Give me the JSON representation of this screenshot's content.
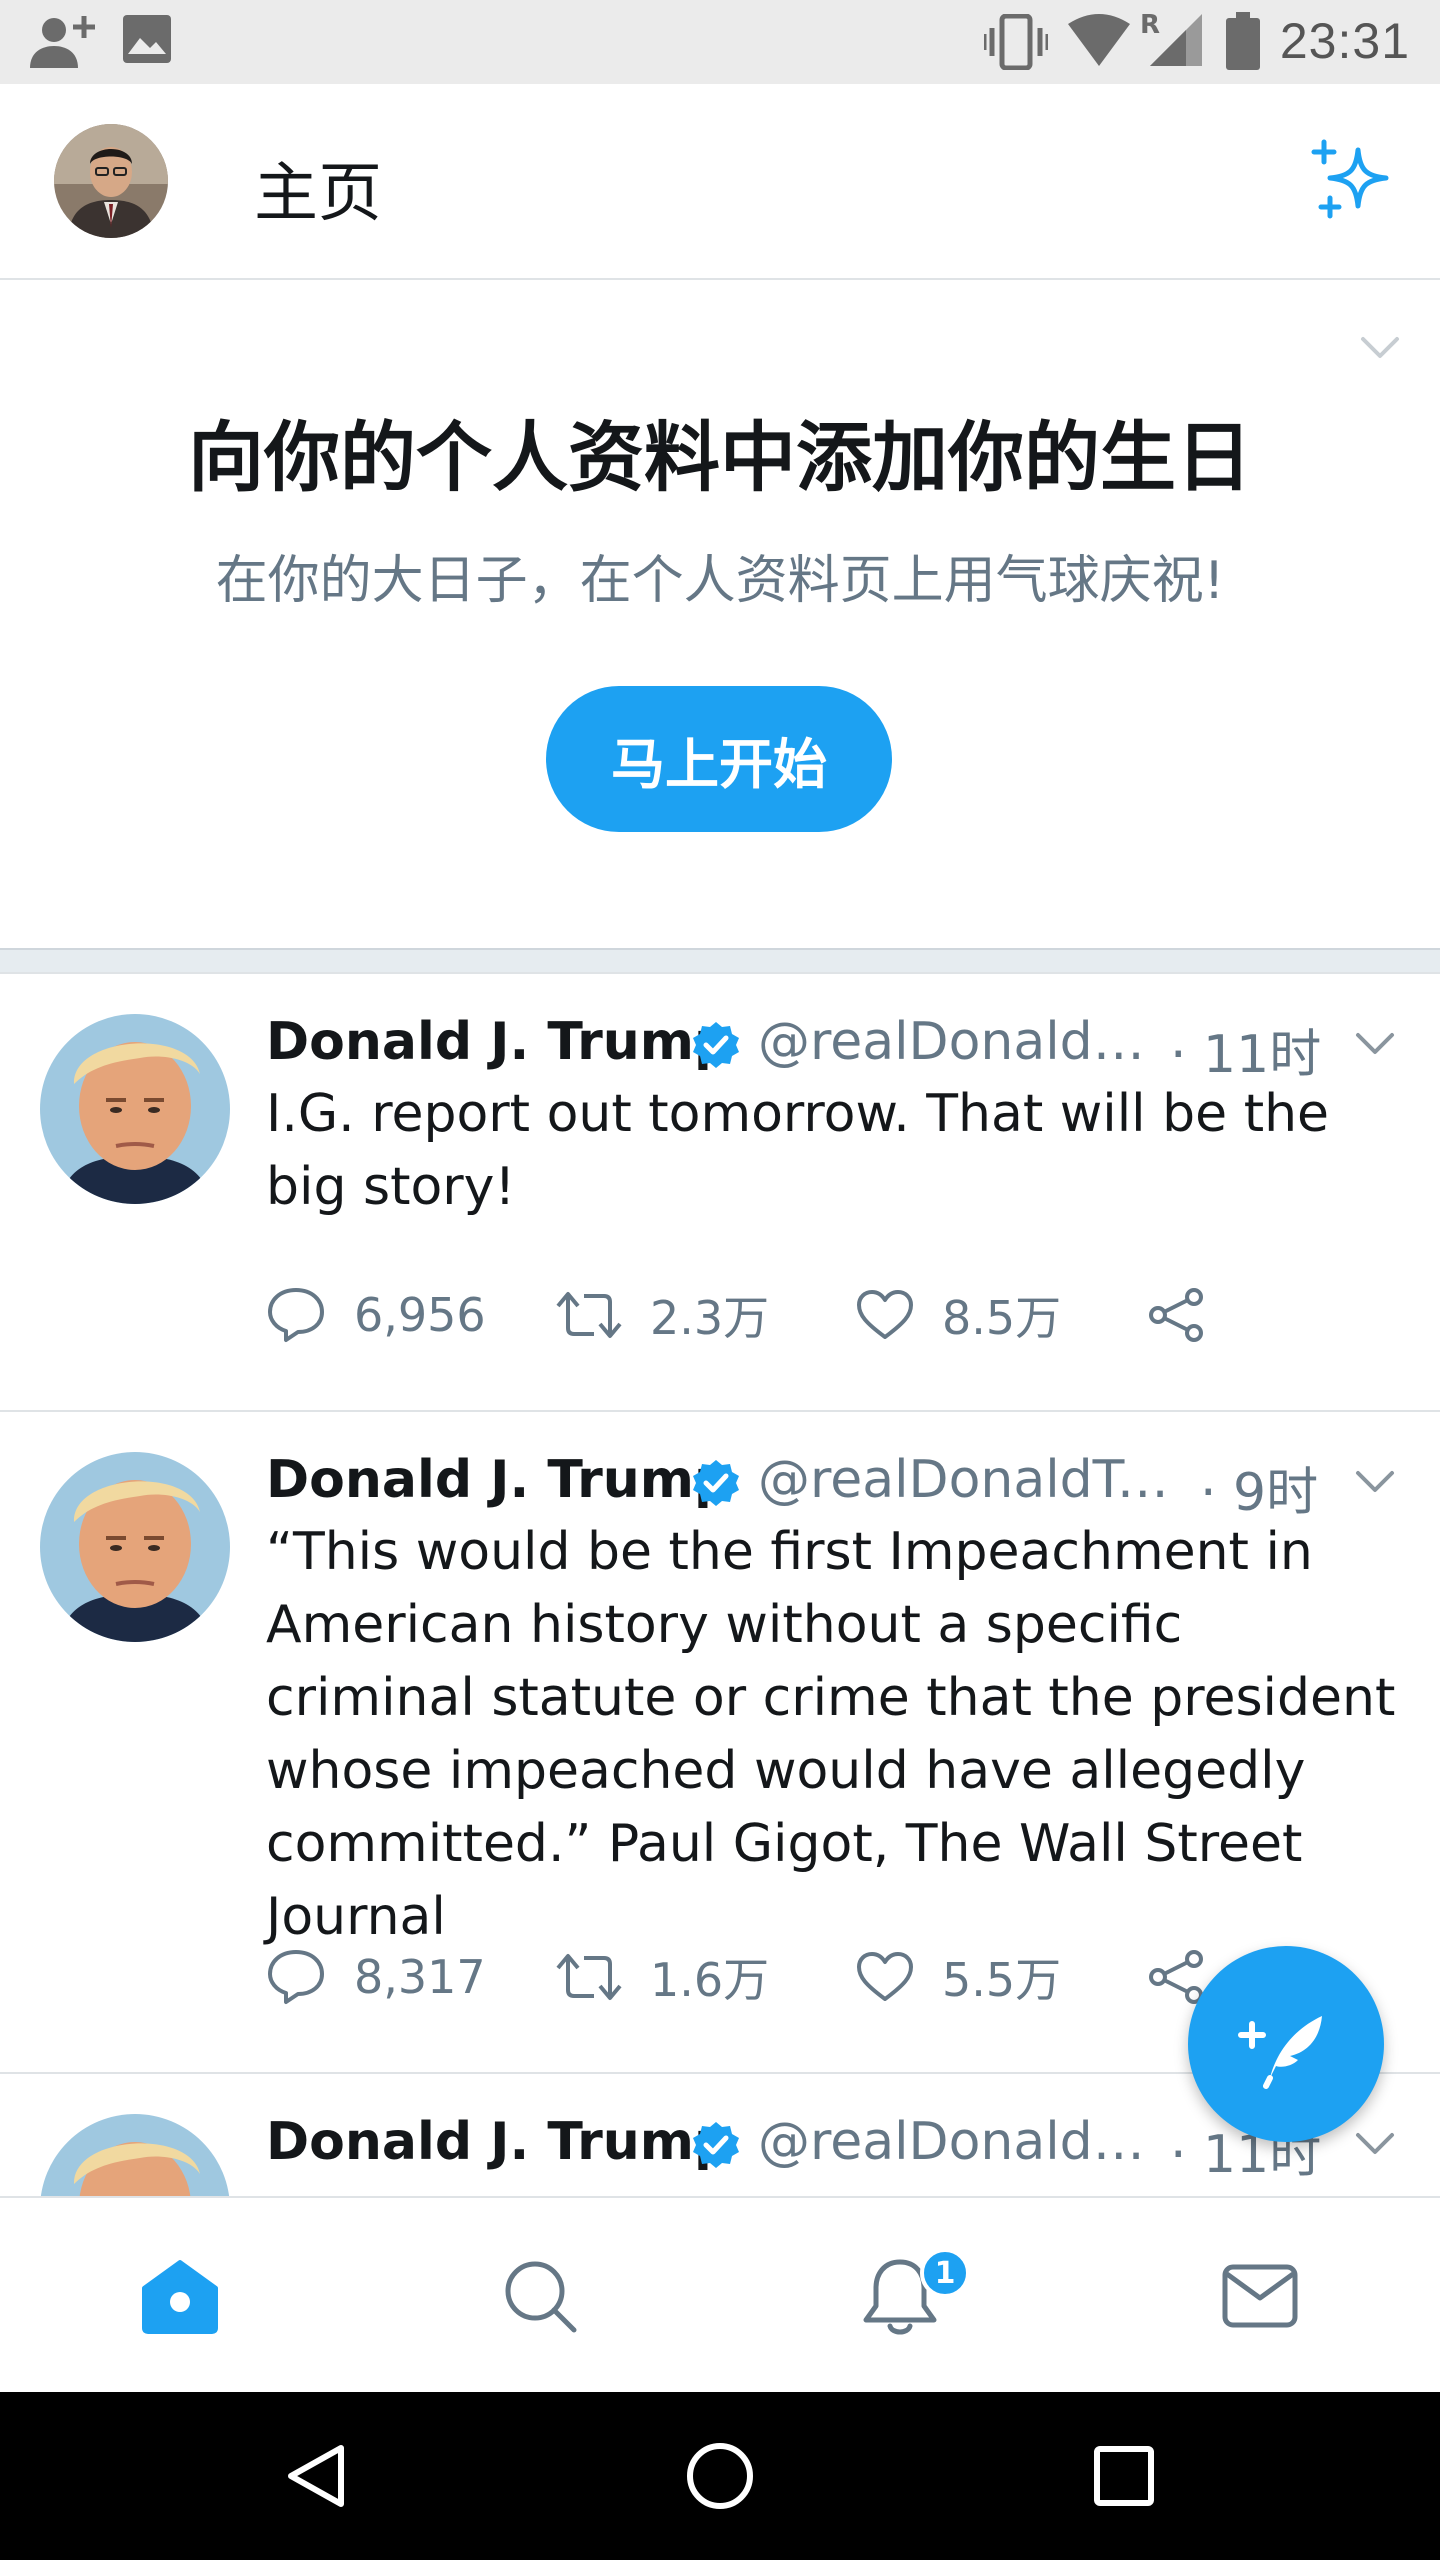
{
  "status_bar": {
    "time": "23:31",
    "network_label": "R",
    "icons": [
      "add-person-icon",
      "image-icon",
      "vibrate-icon",
      "wifi-icon",
      "cell-signal-icon",
      "battery-icon"
    ]
  },
  "header": {
    "title": "主页",
    "icons": [
      "avatar",
      "sparkle-icon"
    ]
  },
  "prompt": {
    "title": "向你的个人资料中添加你的生日",
    "subtitle": "在你的大日子，在个人资料页上用气球庆祝!",
    "button_label": "马上开始",
    "colors": {
      "button": "#1da1f2"
    }
  },
  "tweets": [
    {
      "name": "Donald J. Trump",
      "handle": "@realDonaldTrump",
      "time": "· 11时",
      "text": "I.G. report out tomorrow. That will be the big story!",
      "replies": "6,956",
      "retweets": "2.3万",
      "likes": "8.5万"
    },
    {
      "name": "Donald J. Trump",
      "handle": "@realDonaldTrump",
      "time": "· 9时",
      "text": "“This would be the first Impeachment in American history without a specific criminal statute or crime that the president whose impeached would have allegedly committed.” Paul Gigot, The Wall Street Journal",
      "replies": "8,317",
      "retweets": "1.6万",
      "likes": "5.5万"
    },
    {
      "name": "Donald J. Trump",
      "handle": "@realDonaldTrump",
      "time": "· 11时"
    }
  ],
  "tab_bar": {
    "notifications_badge": "1",
    "tabs": [
      "home-icon",
      "search-icon",
      "bell-icon",
      "mail-icon"
    ]
  },
  "colors": {
    "accent": "#1da1f2",
    "text_primary": "#14171a",
    "text_secondary": "#657786",
    "divider": "#dfe3e6"
  }
}
